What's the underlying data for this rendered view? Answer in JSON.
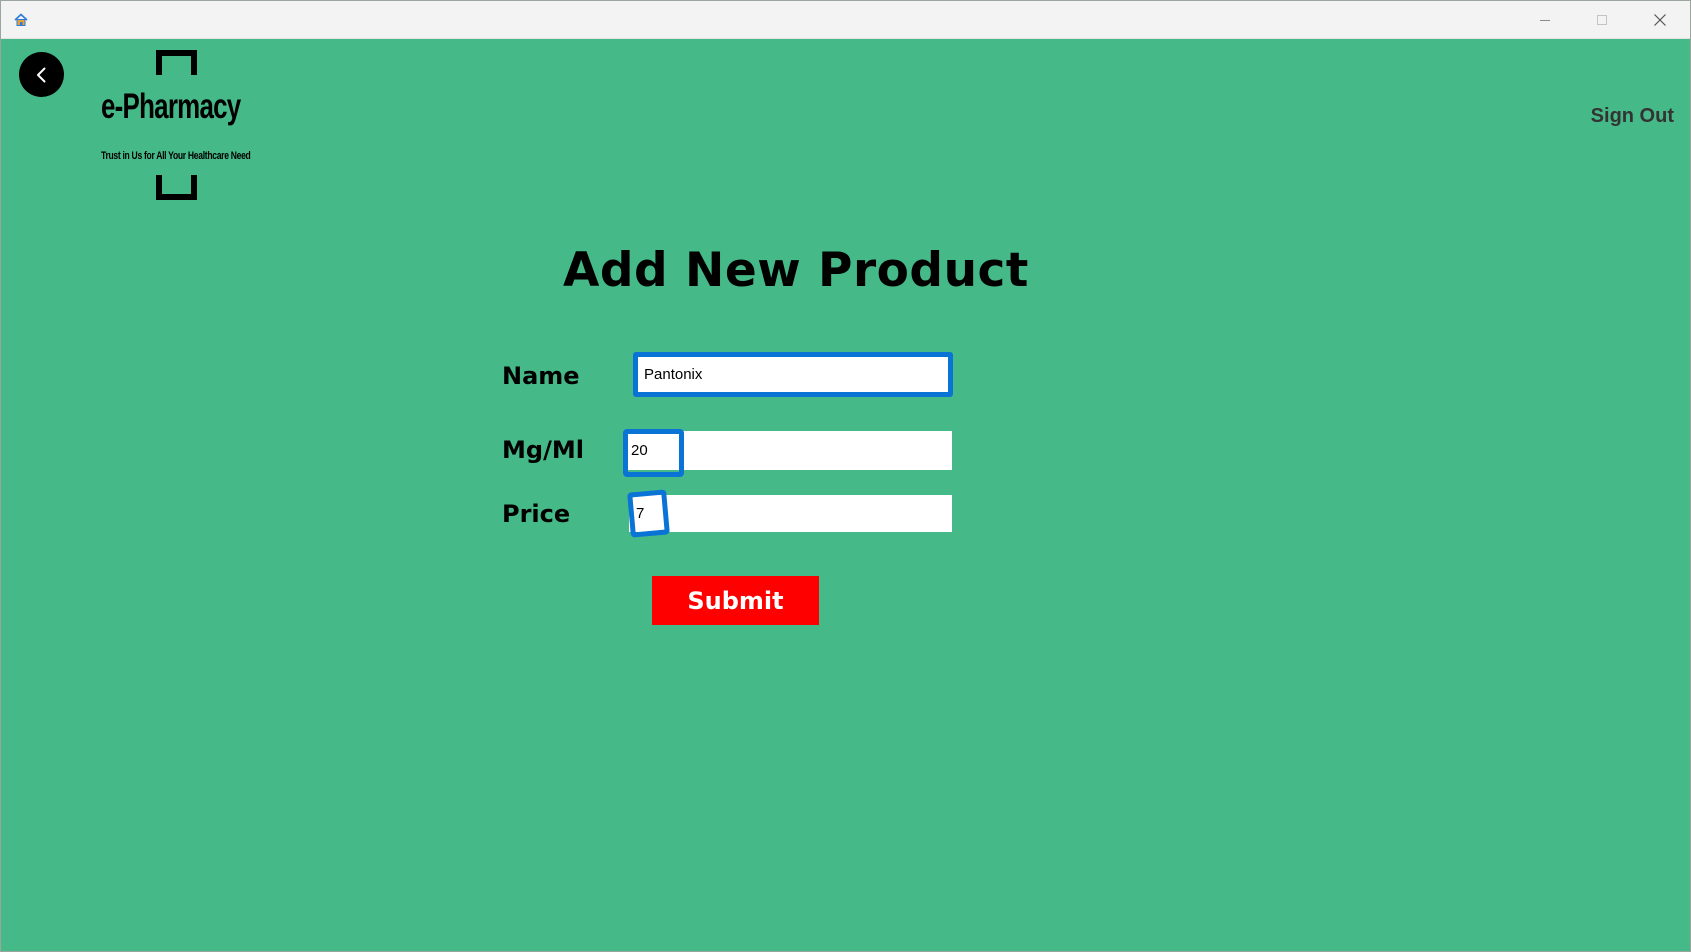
{
  "window": {
    "minimize_icon": "minimize-icon",
    "maximize_icon": "maximize-icon",
    "close_icon": "close-icon",
    "app_icon": "home-icon"
  },
  "header": {
    "back_icon": "chevron-left-icon",
    "logo_title": "e-Pharmacy",
    "logo_tagline": "Trust in Us for All Your Healthcare Need",
    "sign_out_label": "Sign Out"
  },
  "form": {
    "title": "Add New Product",
    "name_label": "Name",
    "name_value": "Pantonix",
    "mg_label": "Mg/Ml",
    "mg_value": "20",
    "price_label": "Price",
    "price_value": "7",
    "submit_label": "Submit"
  },
  "colors": {
    "background": "#45b988",
    "submit": "#fe0000",
    "focus": "#0a74d6"
  }
}
